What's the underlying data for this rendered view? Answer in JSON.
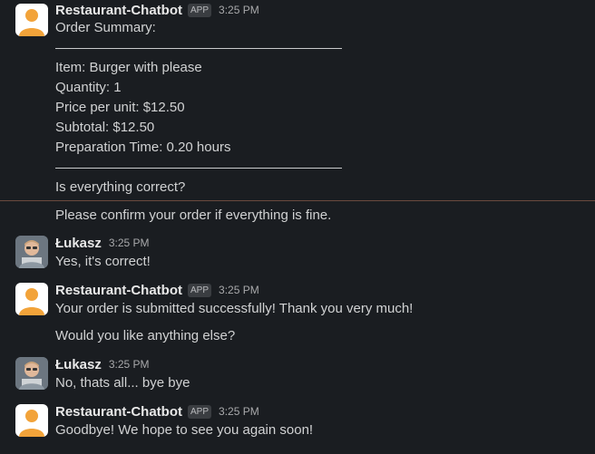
{
  "messages": [
    {
      "sender": "Restaurant-Chatbot",
      "badge": "APP",
      "time": "3:25 PM",
      "lines": [
        "Order Summary:",
        "Item: Burger with please",
        "Quantity: 1",
        "Price per unit: $12.50",
        "Subtotal: $12.50",
        "Preparation Time: 0.20 hours",
        "Is everything correct?",
        "Please confirm your order if everything is fine."
      ]
    },
    {
      "sender": "Łukasz",
      "time": "3:25 PM",
      "lines": [
        "Yes, it's correct!"
      ]
    },
    {
      "sender": "Restaurant-Chatbot",
      "badge": "APP",
      "time": "3:25 PM",
      "lines": [
        "Your order is submitted successfully! Thank you very much!",
        "Would you like anything else?"
      ]
    },
    {
      "sender": "Łukasz",
      "time": "3:25 PM",
      "lines": [
        "No, thats all... bye bye"
      ]
    },
    {
      "sender": "Restaurant-Chatbot",
      "badge": "APP",
      "time": "3:25 PM",
      "lines": [
        "Goodbye! We hope to see you again soon!"
      ]
    }
  ],
  "colors": {
    "background": "#1a1d21",
    "text": "#d1d2d3",
    "bot_avatar_figure": "#f2a33a",
    "divider": "#6b4a3e"
  }
}
